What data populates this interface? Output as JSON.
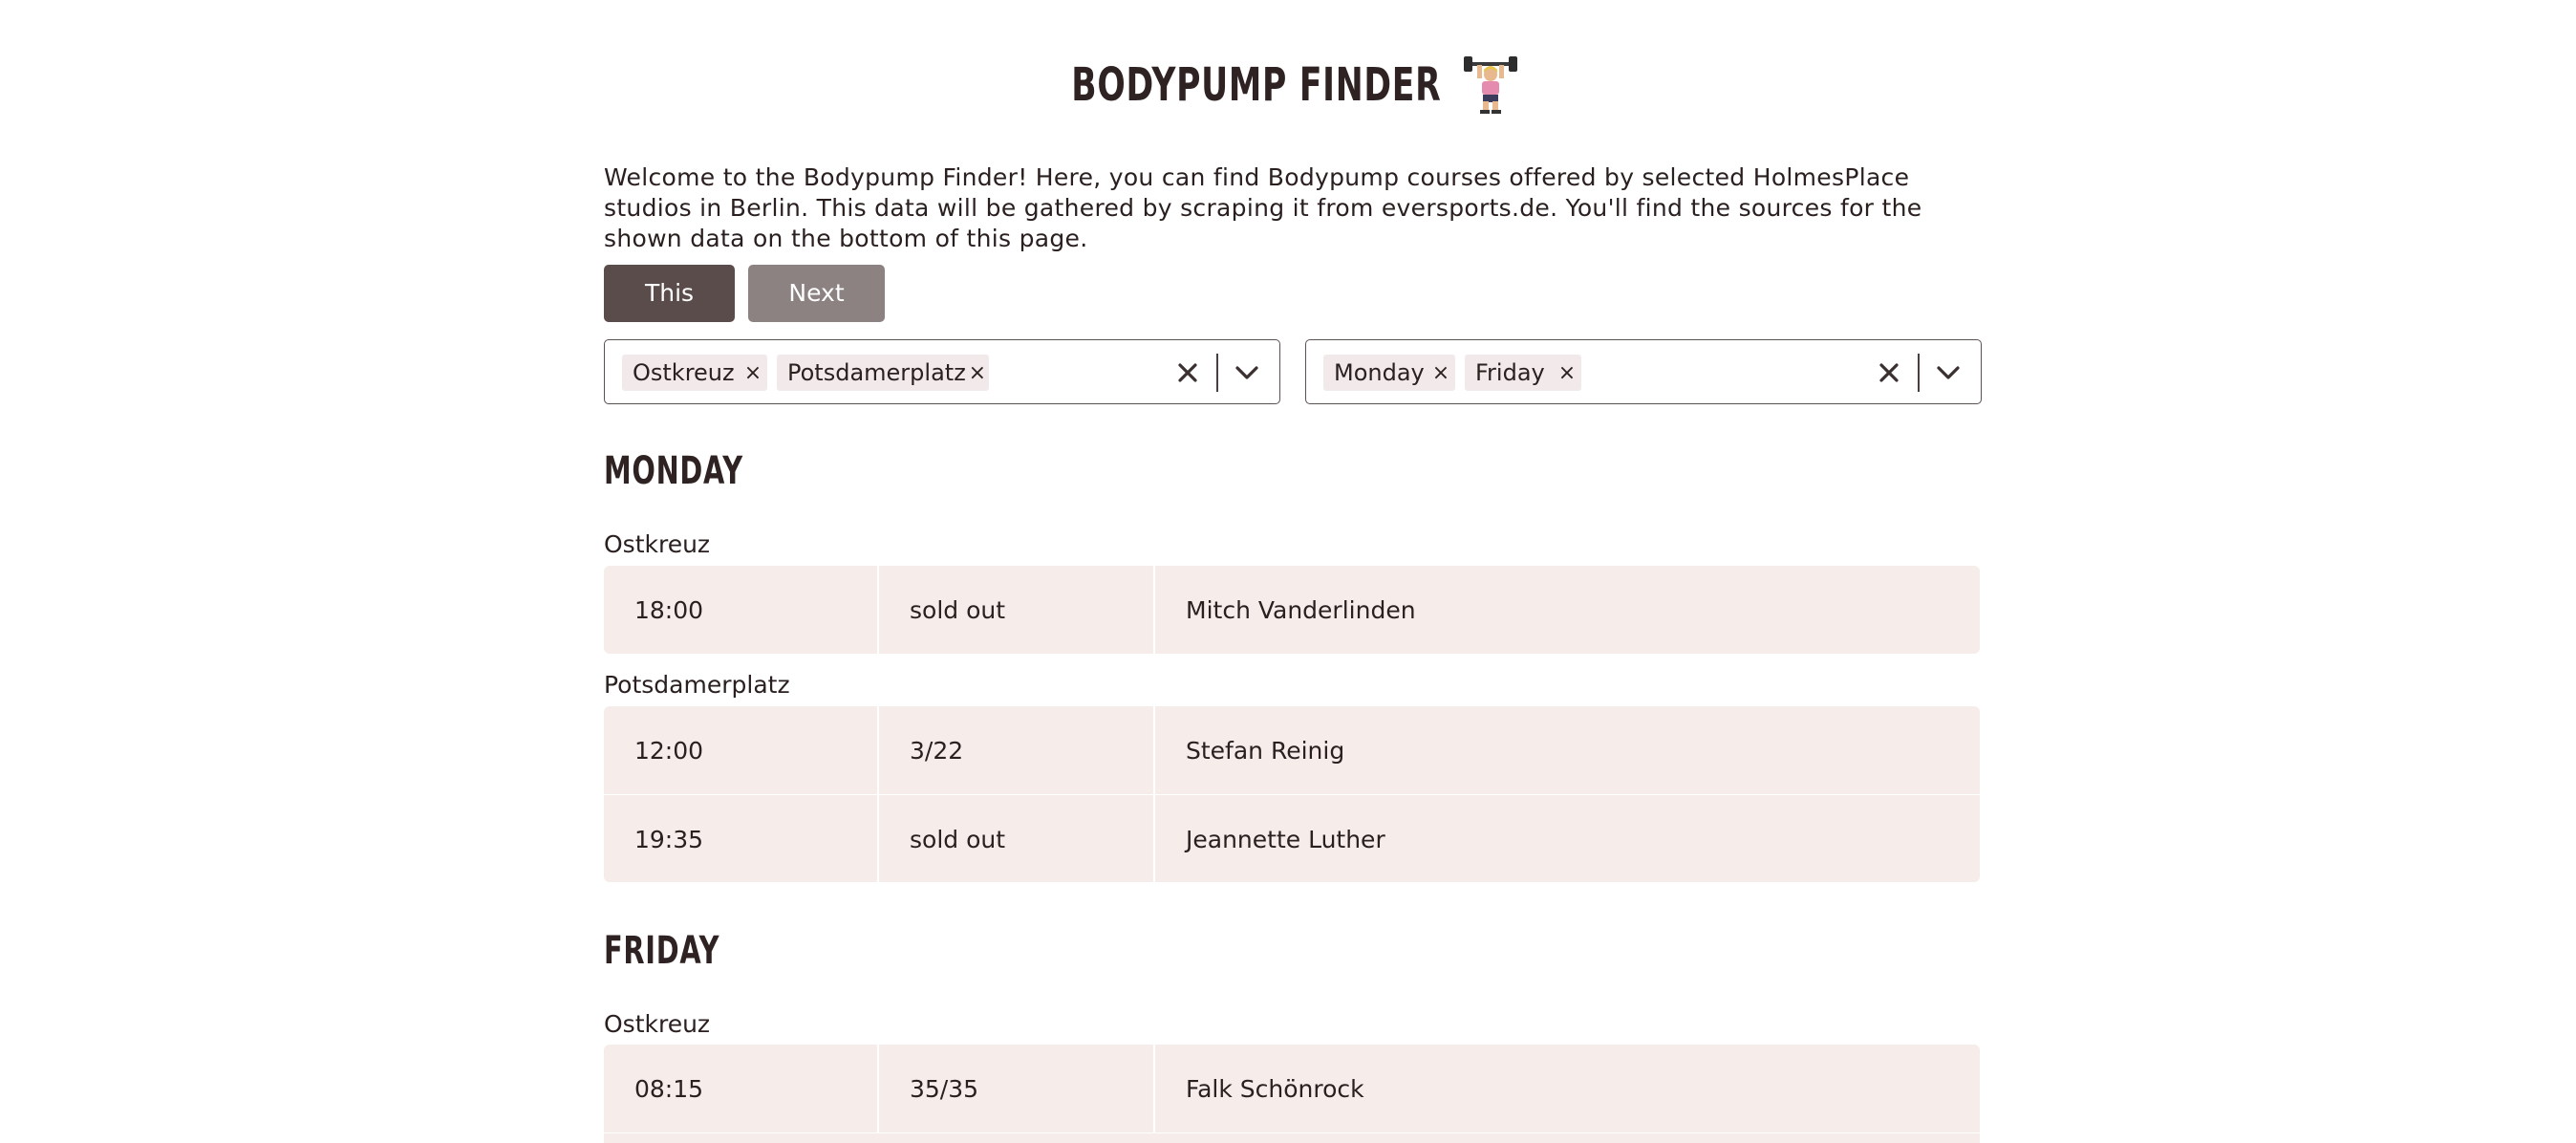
{
  "header": {
    "title": "BODYPUMP FINDER",
    "intro": "Welcome to the Bodypump Finder! Here, you can find Bodypump courses offered by selected HolmesPlace studios in Berlin. This data will be gathered by scraping it from eversports.de. You'll find the sources for the shown data on the bottom of this page."
  },
  "week_tabs": {
    "this_week": "This week",
    "next_week": "Next week",
    "selected": "This week"
  },
  "filters": {
    "locations": [
      "Ostkreuz",
      "Potsdamerplatz"
    ],
    "days": [
      "Monday",
      "Friday"
    ]
  },
  "schedule": {
    "monday": {
      "heading": "MONDAY",
      "studio_1": "Ostkreuz",
      "studio_1_rows": [
        {
          "time": "18:00",
          "spots": "sold out",
          "trainer": "Mitch Vanderlinden"
        }
      ],
      "studio_2": "Potsdamerplatz",
      "studio_2_rows": [
        {
          "time": "12:00",
          "spots": "3/22",
          "trainer": "Stefan Reinig"
        },
        {
          "time": "19:35",
          "spots": "sold out",
          "trainer": "Jeannette Luther"
        }
      ]
    },
    "friday": {
      "heading": "FRIDAY",
      "studio_1": "Ostkreuz",
      "studio_1_rows": [
        {
          "time": "08:15",
          "spots": "35/35",
          "trainer": "Falk Schönrock"
        }
      ]
    }
  },
  "colors": {
    "primary_button": "#5a4c4b",
    "secondary_button": "#8c8282",
    "row_background": "#f6ecea",
    "chip_background": "#f2eaea"
  }
}
